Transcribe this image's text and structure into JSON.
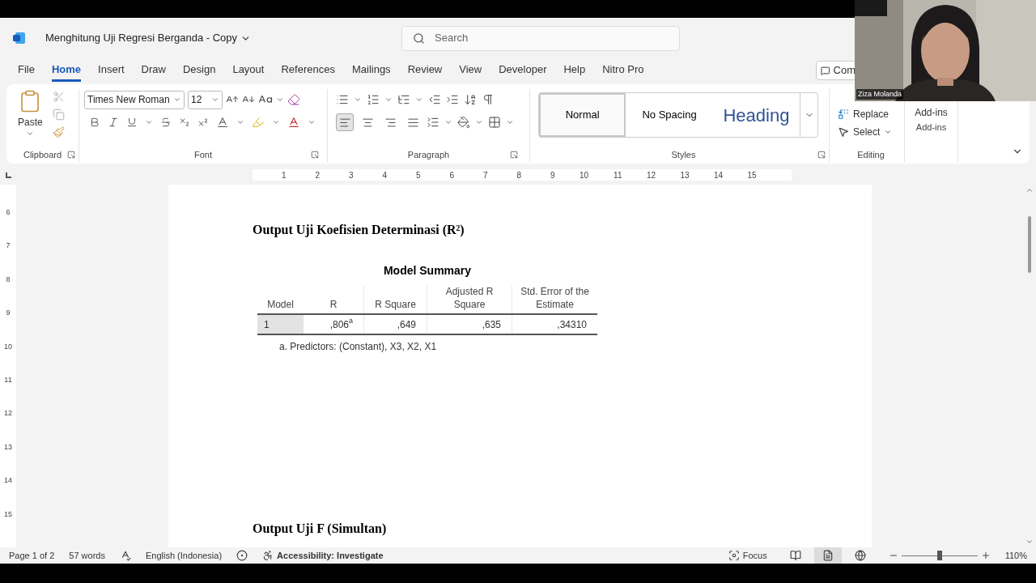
{
  "title_bar": {
    "doc_title": "Menghitung Uji Regresi Berganda - Copy",
    "search_placeholder": "Search"
  },
  "menu_tabs": [
    {
      "label": "File",
      "selected": false
    },
    {
      "label": "Home",
      "selected": true
    },
    {
      "label": "Insert",
      "selected": false
    },
    {
      "label": "Draw",
      "selected": false
    },
    {
      "label": "Design",
      "selected": false
    },
    {
      "label": "Layout",
      "selected": false
    },
    {
      "label": "References",
      "selected": false
    },
    {
      "label": "Mailings",
      "selected": false
    },
    {
      "label": "Review",
      "selected": false
    },
    {
      "label": "View",
      "selected": false
    },
    {
      "label": "Developer",
      "selected": false
    },
    {
      "label": "Help",
      "selected": false
    },
    {
      "label": "Nitro Pro",
      "selected": false
    }
  ],
  "comments_button": "Com",
  "ribbon": {
    "clipboard": {
      "paste": "Paste",
      "group": "Clipboard"
    },
    "font": {
      "family": "Times New Roman",
      "size": "12",
      "group": "Font"
    },
    "paragraph": {
      "group": "Paragraph",
      "alignments": [
        {
          "kind": "left",
          "selected": true
        },
        {
          "kind": "center",
          "selected": false
        },
        {
          "kind": "right",
          "selected": false
        },
        {
          "kind": "justify",
          "selected": false
        }
      ]
    },
    "styles": {
      "group": "Styles",
      "items": [
        {
          "label": "Normal",
          "kind": "normal",
          "selected": true
        },
        {
          "label": "No Spacing",
          "kind": "plain",
          "selected": false
        },
        {
          "label": "Heading",
          "kind": "heading",
          "selected": false
        }
      ]
    },
    "editing": {
      "replace": "Replace",
      "select": "Select",
      "group": "Editing"
    },
    "addins": {
      "button": "Add-ins",
      "group": "Add-ins"
    }
  },
  "ruler": {
    "numbers": [
      "1",
      "2",
      "3",
      "4",
      "5",
      "6",
      "7",
      "8",
      "9",
      "10",
      "11",
      "12",
      "13",
      "14",
      "15"
    ]
  },
  "vertical_ruler": [
    "6",
    "7",
    "8",
    "9",
    "10",
    "11",
    "12",
    "13",
    "14",
    "15"
  ],
  "document": {
    "heading_1": "Output Uji Koefisien Determinasi (R²)",
    "table": {
      "title": "Model Summary",
      "columns": [
        "Model",
        "R",
        "R Square",
        "Adjusted R Square",
        "Std. Error of the Estimate"
      ],
      "rows": [
        [
          "1",
          ",806$^{a}$",
          ",649",
          ",635",
          ",34310"
        ]
      ],
      "footnote": "a. Predictors: (Constant), X3, X2, X1"
    },
    "heading_2": "Output Uji F (Simultan)"
  },
  "status_bar": {
    "page": "Page 1 of 2",
    "words": "57 words",
    "language": "English (Indonesia)",
    "accessibility": "Accessibility: Investigate",
    "focus": "Focus",
    "views": [
      {
        "kind": "read",
        "selected": false
      },
      {
        "kind": "print",
        "selected": true
      },
      {
        "kind": "web",
        "selected": false
      }
    ],
    "zoom": {
      "level": 0.5,
      "label": "110%"
    }
  },
  "video": {
    "participant_name": "Ziza Molanda"
  }
}
